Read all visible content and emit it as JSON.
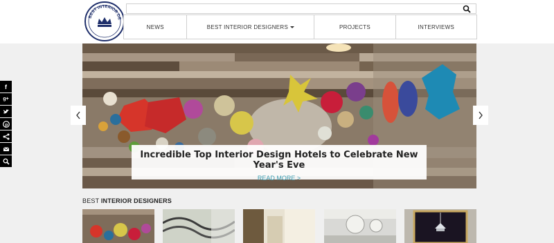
{
  "logo": {
    "text": "BEST INTERIOR DESIGNERS"
  },
  "nav": {
    "items": [
      {
        "label": "NEWS"
      },
      {
        "label": "BEST INTERIOR DESIGNERS"
      },
      {
        "label": "PROJECTS"
      },
      {
        "label": "INTERVIEWS"
      }
    ]
  },
  "social": {
    "icons": [
      "facebook-icon",
      "google-plus-icon",
      "twitter-icon",
      "pinterest-icon",
      "share-icon",
      "email-icon",
      "search-icon"
    ]
  },
  "hero": {
    "title": "Incredible Top Interior Design Hotels to Celebrate New Year's Eve",
    "read_more": "READ MORE >"
  },
  "section": {
    "prefix": "BEST",
    "title": "INTERIOR DESIGNERS"
  },
  "colors": {
    "accent": "#3a9bb0",
    "social_bg": "#000000"
  }
}
